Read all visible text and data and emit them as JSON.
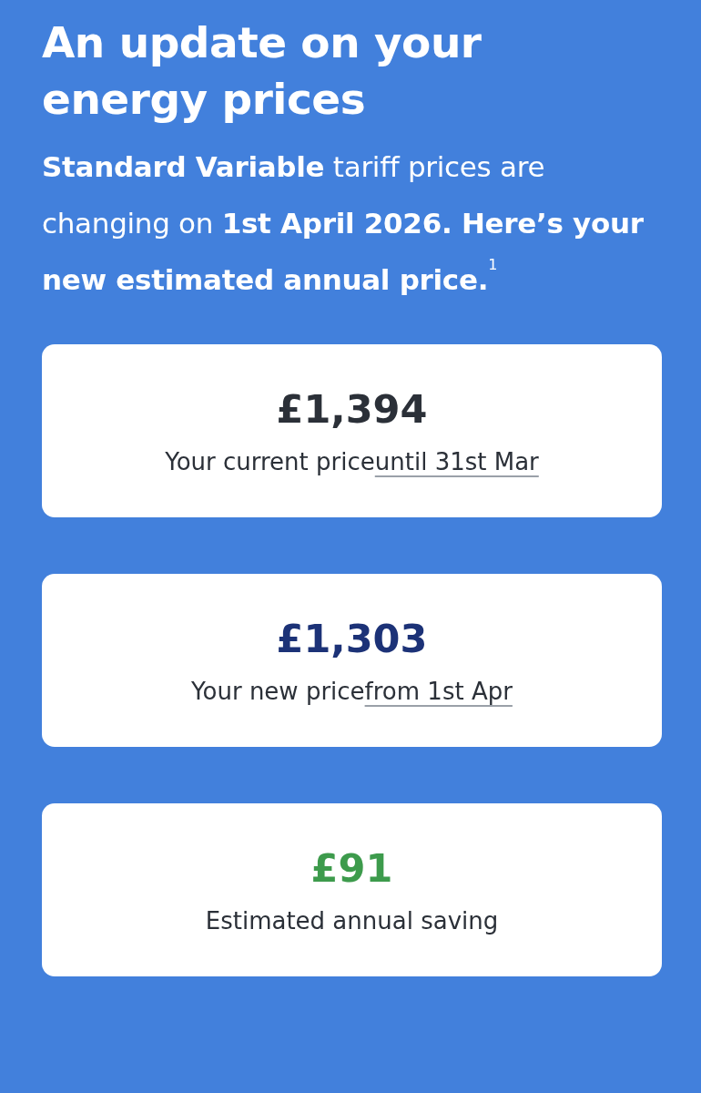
{
  "heading": "An update on your energy prices",
  "intro": "**Standard Variable** tariff prices are changing on **1st April 2026. Here’s your new estimated annual price.**$^{1}$",
  "cards": [
    {
      "amount": "£1,394",
      "color": "#2b3038",
      "caption": "Your current price",
      "link": "until 31st Mar"
    },
    {
      "amount": "£1,303",
      "color": "#1c3277",
      "caption": "Your new price",
      "link": "from 1st Apr"
    },
    {
      "amount": "£91",
      "color": "#3d9b4c",
      "caption": "Estimated annual saving"
    }
  ]
}
